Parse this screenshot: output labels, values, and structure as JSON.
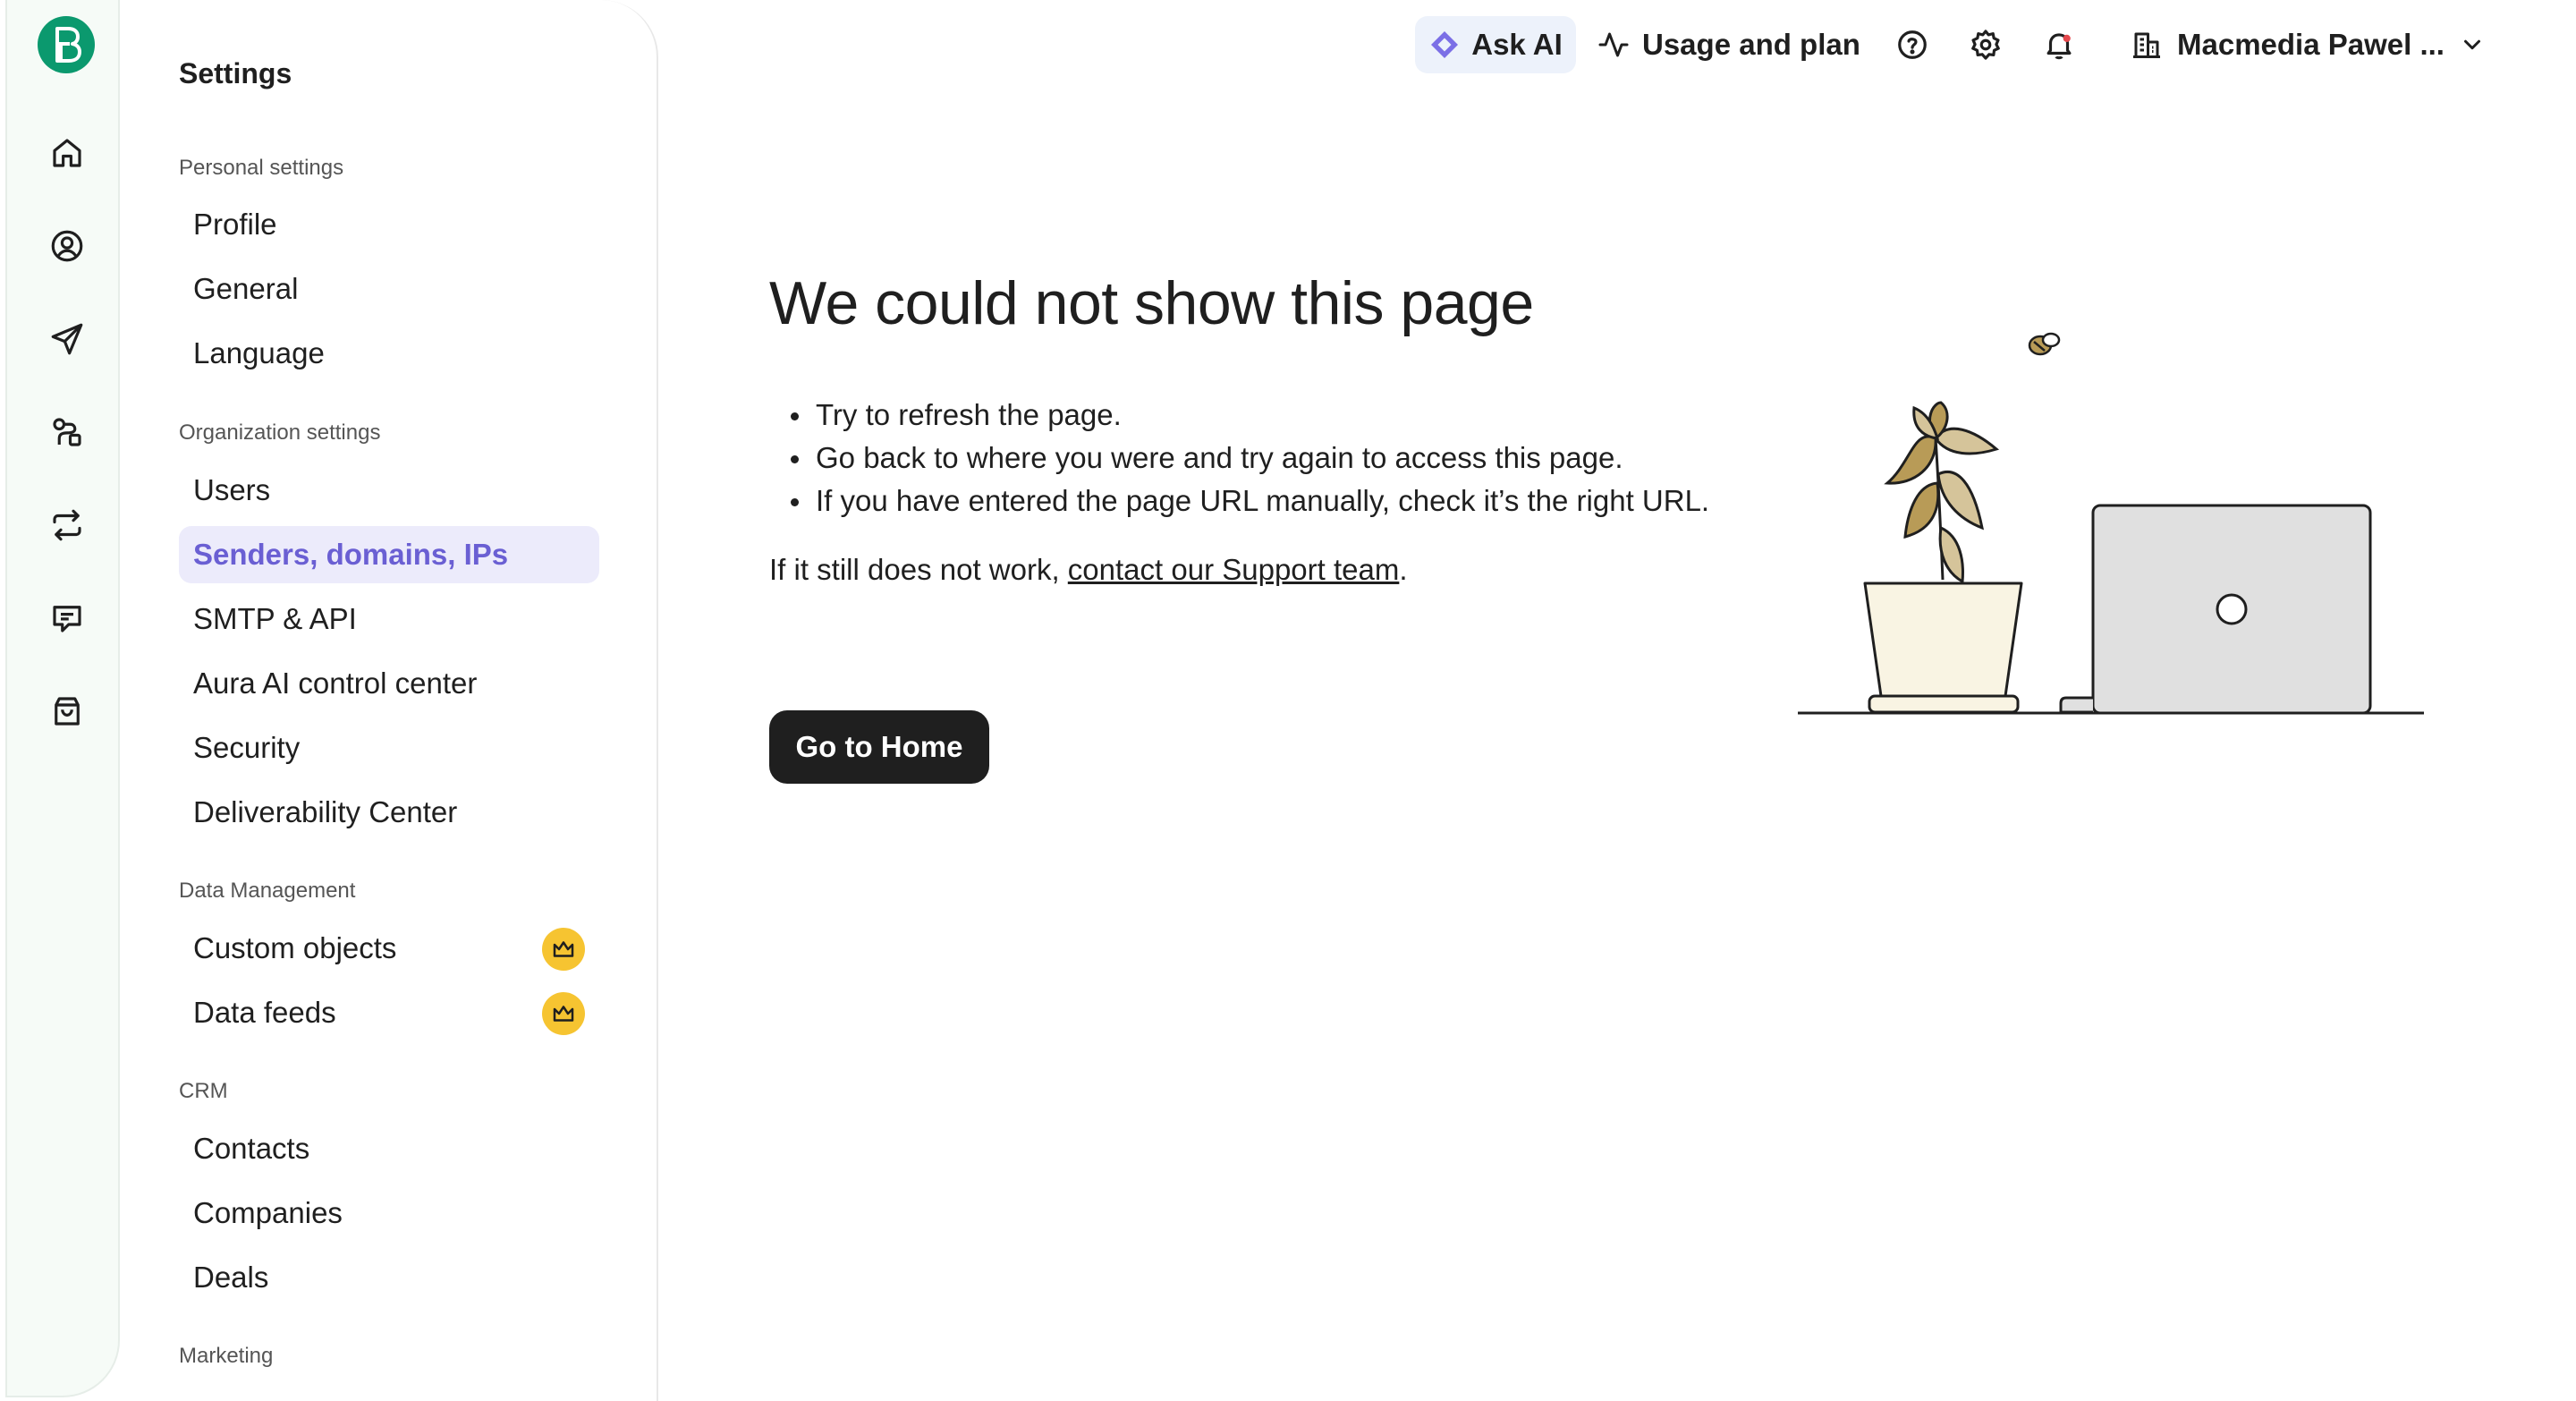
{
  "rail": {
    "logo_letter": "B",
    "items": [
      "home-icon",
      "contacts-icon",
      "campaigns-icon",
      "automations-icon",
      "transactional-icon",
      "conversations-icon",
      "shop-icon"
    ]
  },
  "sidebar": {
    "title": "Settings",
    "sections": {
      "personal": "Personal settings",
      "organization": "Organization settings",
      "data": "Data Management",
      "crm": "CRM",
      "marketing": "Marketing"
    },
    "items": {
      "profile": "Profile",
      "general": "General",
      "language": "Language",
      "users": "Users",
      "senders": "Senders, domains, IPs",
      "smtp": "SMTP & API",
      "aura": "Aura AI control center",
      "security": "Security",
      "deliverability": "Deliverability Center",
      "custom_objects": "Custom objects",
      "data_feeds": "Data feeds",
      "contacts": "Contacts",
      "companies": "Companies",
      "deals": "Deals"
    }
  },
  "topbar": {
    "ask_ai": "Ask AI",
    "usage": "Usage and plan",
    "account": "Macmedia Pawel ..."
  },
  "error": {
    "title": "We could not show this page",
    "hints": [
      "Try to refresh the page.",
      "Go back to where you were and try again to access this page.",
      "If you have entered the page URL manually, check it’s the right URL."
    ],
    "still_prefix": "If it still does not work, ",
    "support_link": "contact our Support team",
    "still_suffix": ".",
    "home_button": "Go to Home"
  },
  "colors": {
    "brand": "#0b996e",
    "active_bg": "#ecebfb",
    "active_text": "#6a5fd3",
    "crown": "#f6c431",
    "button": "#1f1f1f"
  }
}
